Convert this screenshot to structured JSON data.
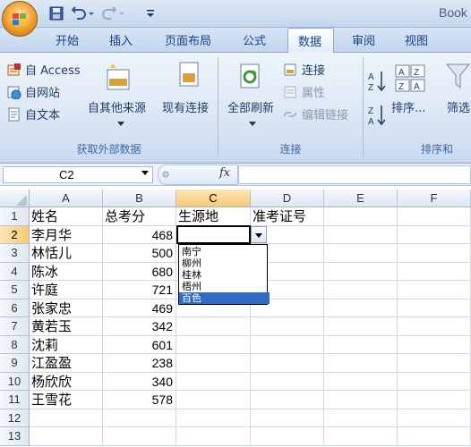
{
  "window": {
    "title": "Book"
  },
  "tabs": [
    {
      "label": "开始"
    },
    {
      "label": "插入"
    },
    {
      "label": "页面布局"
    },
    {
      "label": "公式"
    },
    {
      "label": "数据",
      "active": true
    },
    {
      "label": "审阅"
    },
    {
      "label": "视图"
    }
  ],
  "ribbon": {
    "get_external": {
      "from_access": "自 Access",
      "from_web": "自网站",
      "from_text": "自文本",
      "from_other": "自其他来源",
      "existing": "现有连接",
      "group_label": "获取外部数据"
    },
    "connections": {
      "refresh_all": "全部刷新",
      "connections": "连接",
      "properties": "属性",
      "edit_links": "编辑链接",
      "group_label": "连接"
    },
    "sort_filter": {
      "sort": "排序...",
      "filter": "筛选",
      "group_label": "排序和"
    }
  },
  "formula_bar": {
    "name_box": "C2",
    "fx": "fx",
    "value": ""
  },
  "columns": [
    "A",
    "B",
    "C",
    "D",
    "E",
    "F"
  ],
  "selected_column": "C",
  "rows": [
    {
      "n": "1",
      "a": "姓名",
      "b": "总考分",
      "c": "生源地",
      "d": "准考证号"
    },
    {
      "n": "2",
      "a": "李月华",
      "b": "468"
    },
    {
      "n": "3",
      "a": "林恬儿",
      "b": "500"
    },
    {
      "n": "4",
      "a": "陈冰",
      "b": "680"
    },
    {
      "n": "5",
      "a": "许庭",
      "b": "721"
    },
    {
      "n": "6",
      "a": "张家忠",
      "b": "469"
    },
    {
      "n": "7",
      "a": "黄若玉",
      "b": "342"
    },
    {
      "n": "8",
      "a": "沈莉",
      "b": "601"
    },
    {
      "n": "9",
      "a": "江盈盈",
      "b": "238"
    },
    {
      "n": "10",
      "a": "杨欣欣",
      "b": "340"
    },
    {
      "n": "11",
      "a": "王雪花",
      "b": "578"
    },
    {
      "n": "12"
    },
    {
      "n": "13"
    }
  ],
  "selected_row": "2",
  "dropdown": {
    "options": [
      "南宁",
      "柳州",
      "桂林",
      "梧州",
      "百色"
    ],
    "highlighted": "百色"
  },
  "colors": {
    "ribbon_text": "#15428b",
    "selection": "#316ac5",
    "header_highlight": "#f8c974"
  }
}
